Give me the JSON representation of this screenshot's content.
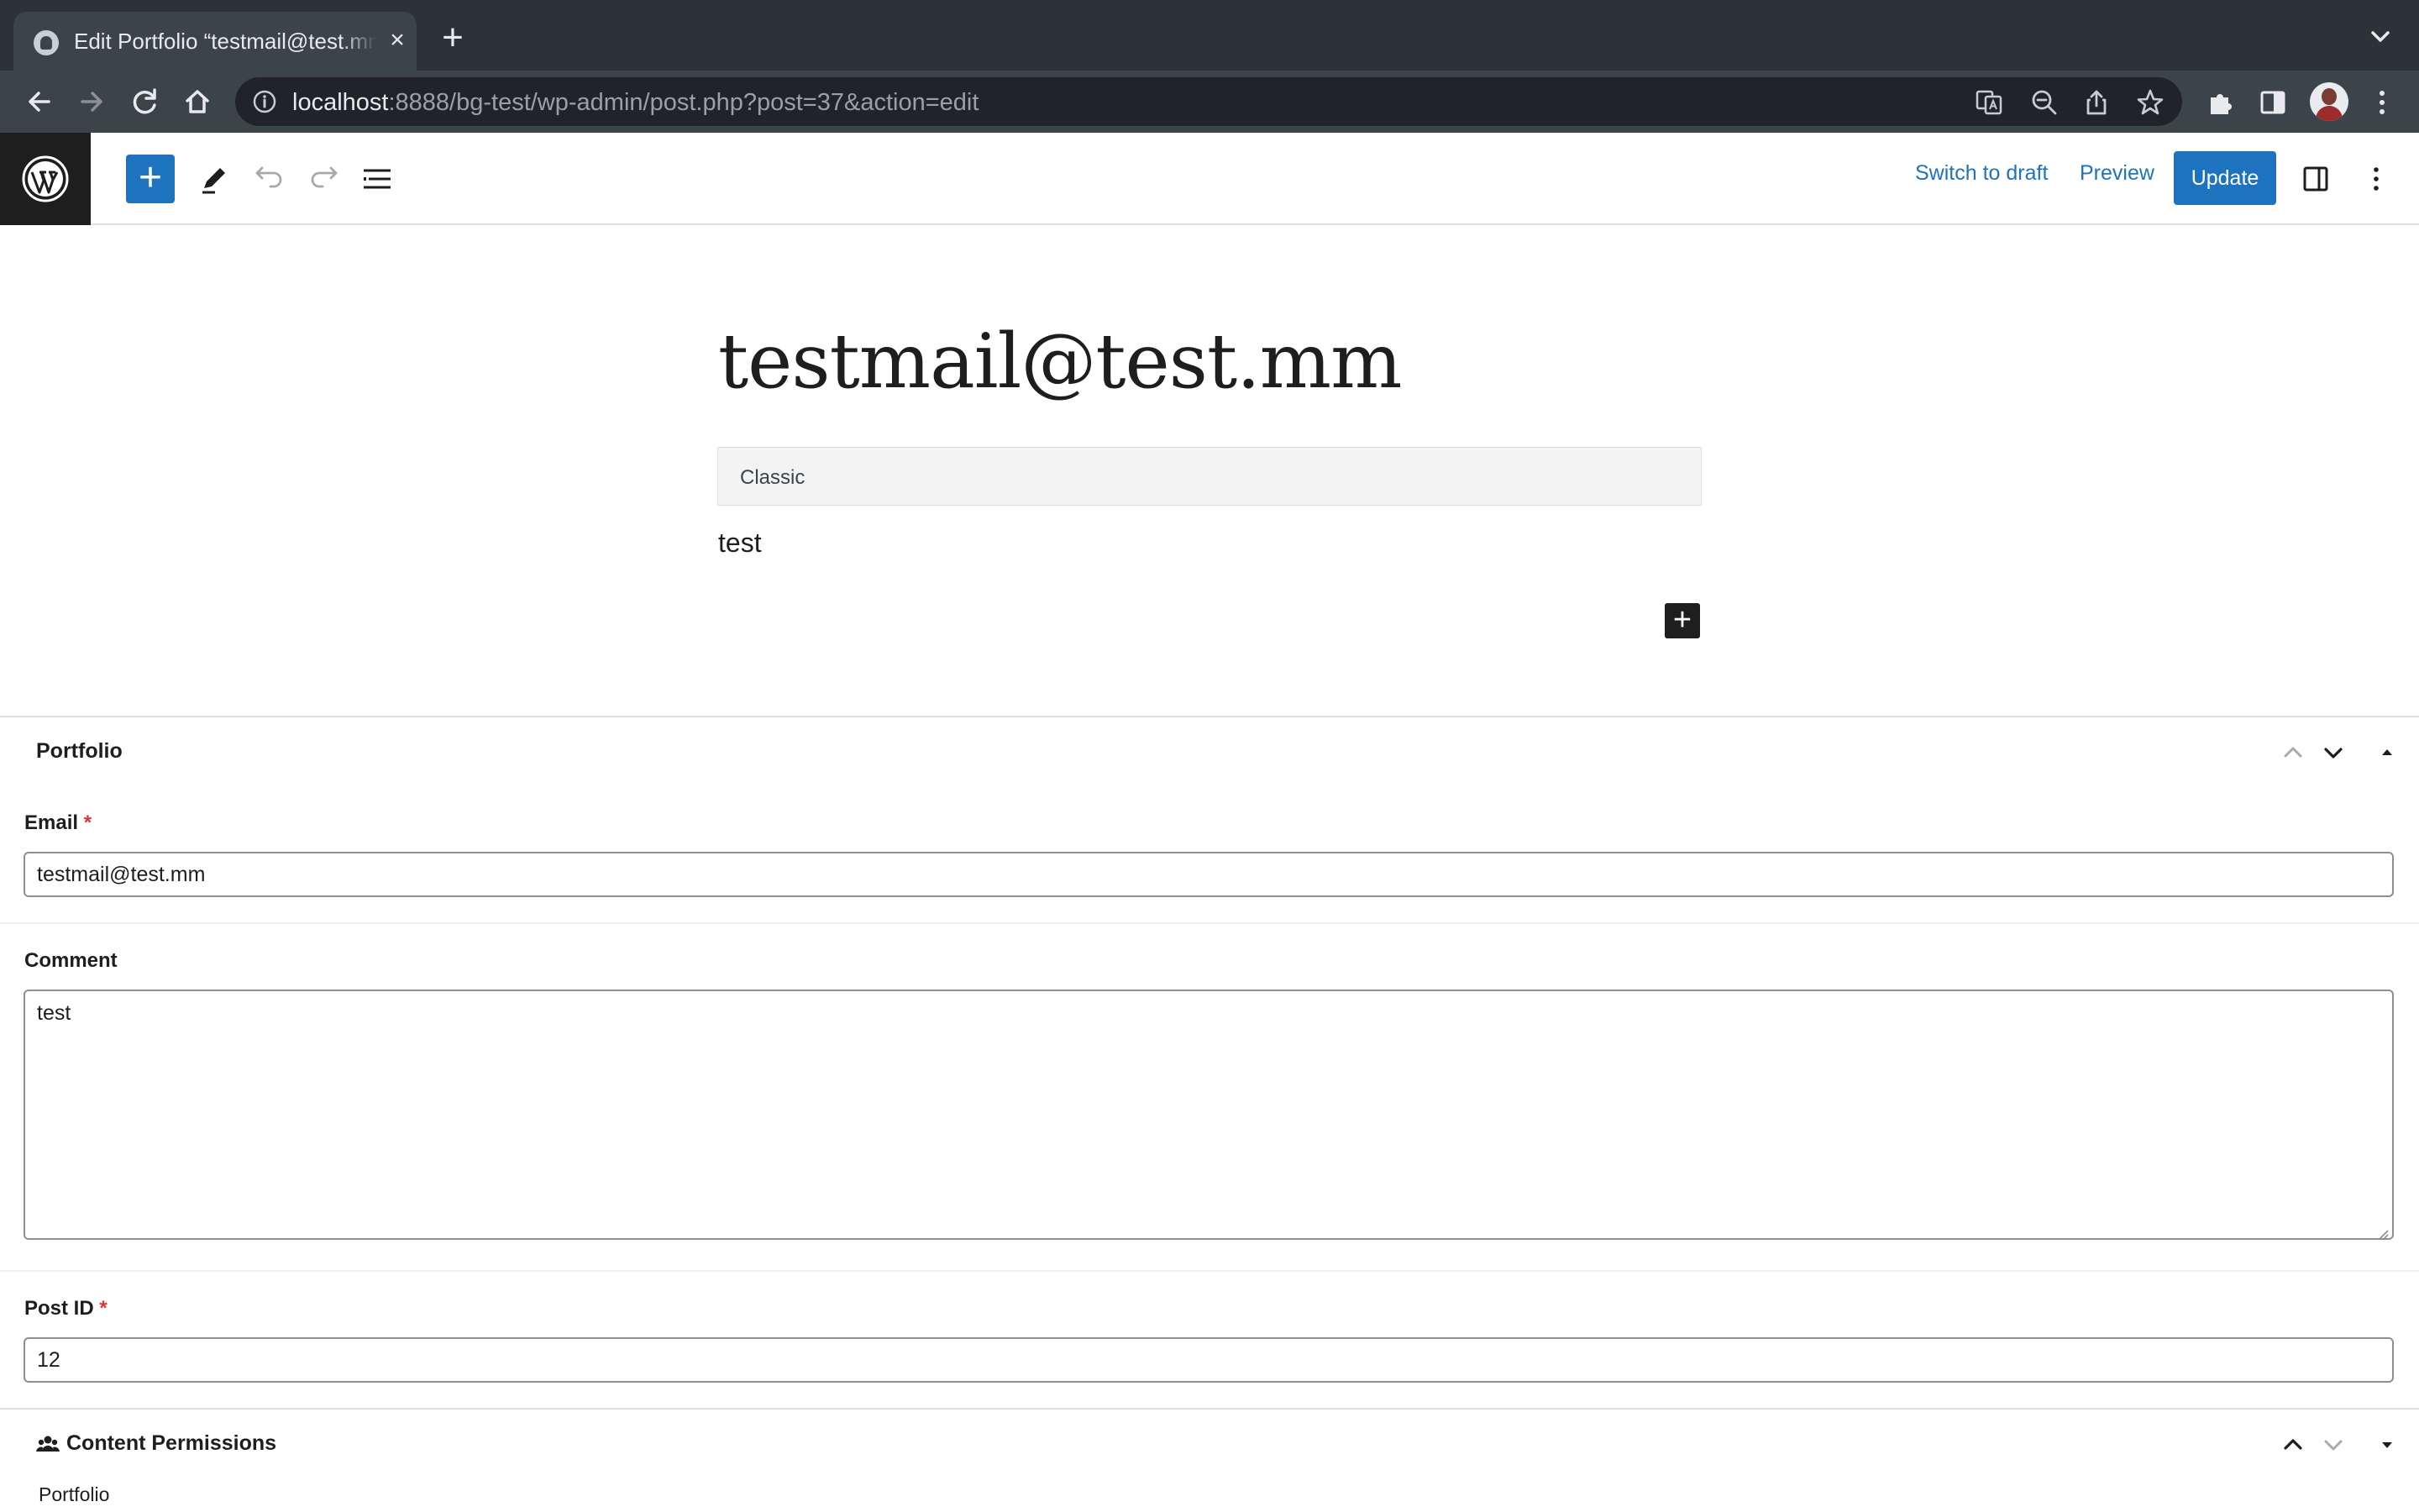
{
  "browser": {
    "tab_title": "Edit Portfolio “testmail@test.mm”",
    "close_tab": "×",
    "new_tab": "+",
    "url_host": "localhost",
    "url_rest": ":8888/bg-test/wp-admin/post.php?post=37&action=edit"
  },
  "editor_header": {
    "inserter": "+",
    "switch_to_draft": "Switch to draft",
    "preview": "Preview",
    "update": "Update"
  },
  "canvas": {
    "post_title": "testmail@test.mm",
    "classic_block_label": "Classic",
    "content": "test",
    "add_block": "+"
  },
  "portfolio_box": {
    "title": "Portfolio",
    "fields": [
      {
        "label": "Email",
        "required_mark": "*",
        "value": "testmail@test.mm"
      },
      {
        "label": "Comment",
        "value": "test"
      },
      {
        "label": "Post ID",
        "required_mark": "*",
        "value": "12"
      }
    ]
  },
  "permissions_box": {
    "title": "Content Permissions",
    "first_item": "Portfolio"
  },
  "colors": {
    "wp_blue": "#1e73be",
    "required_red": "#d63638",
    "chrome_dark": "#2b3238"
  }
}
